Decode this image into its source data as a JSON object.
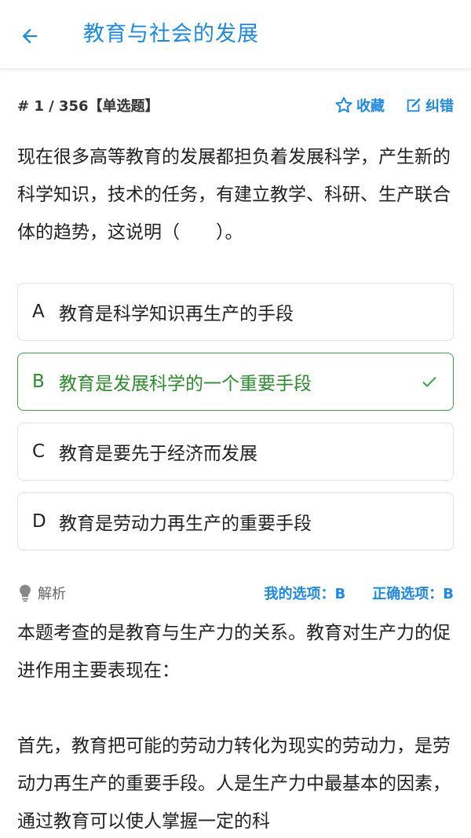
{
  "header": {
    "back_icon": "arrow-left-icon",
    "title": "教育与社会的发展"
  },
  "meta": {
    "index": "# 1 / 356【单选题】",
    "favorite_label": "收藏",
    "report_label": "纠错"
  },
  "question": {
    "text": "现在很多高等教育的发展都担负着发展科学，产生新的科学知识，技术的任务，有建立教学、科研、生产联合体的趋势，这说明（　　）。"
  },
  "options": [
    {
      "letter": "A",
      "text": "教育是科学知识再生产的手段"
    },
    {
      "letter": "B",
      "text": "教育是发展科学的一个重要手段",
      "correct": true
    },
    {
      "letter": "C",
      "text": "教育是要先于经济而发展"
    },
    {
      "letter": "D",
      "text": "教育是劳动力再生产的重要手段"
    }
  ],
  "analysis": {
    "label": "解析",
    "my_answer": "我的选项：B",
    "correct_answer": "正确选项：B",
    "para1": "本题考查的是教育与生产力的关系。教育对生产力的促进作用主要表现在：",
    "para2": " 首先，教育把可能的劳动力转化为现实的劳动力，是劳动力再生产的重要手段。人是生产力中最基本的因素，通过教育可以使人掌握一定的科"
  },
  "colors": {
    "accent": "#1e88e5",
    "correct": "#43a047"
  }
}
